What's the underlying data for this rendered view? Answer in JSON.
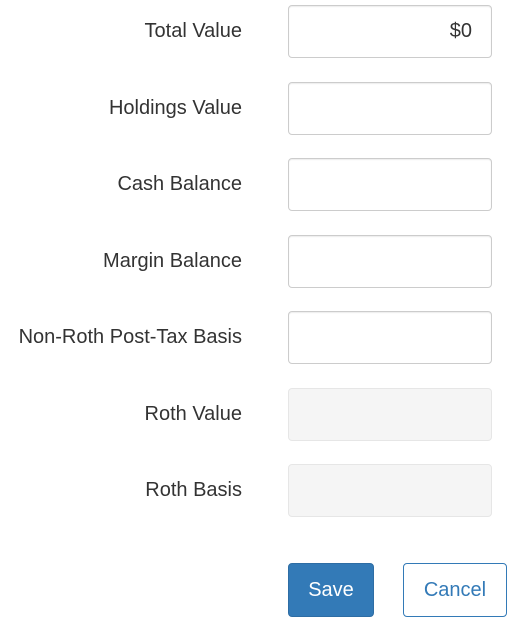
{
  "form": {
    "fields": [
      {
        "label": "Total Value",
        "value": "$0",
        "disabled": false
      },
      {
        "label": "Holdings Value",
        "value": "",
        "disabled": false
      },
      {
        "label": "Cash Balance",
        "value": "",
        "disabled": false
      },
      {
        "label": "Margin Balance",
        "value": "",
        "disabled": false
      },
      {
        "label": "Non-Roth Post-Tax Basis",
        "value": "",
        "disabled": false
      },
      {
        "label": "Roth Value",
        "value": "",
        "disabled": true
      },
      {
        "label": "Roth Basis",
        "value": "",
        "disabled": true
      }
    ],
    "save_label": "Save",
    "cancel_label": "Cancel"
  },
  "colors": {
    "primary": "#337ab7",
    "text": "#333333",
    "disabled_bg": "#f5f5f5"
  }
}
